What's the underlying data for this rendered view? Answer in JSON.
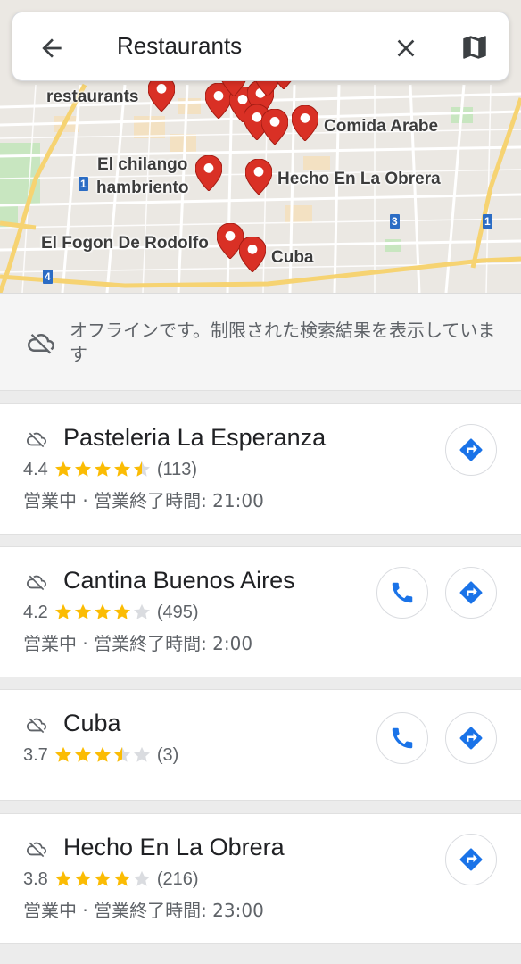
{
  "search": {
    "query": "Restaurants",
    "back_icon": "arrow-back-icon",
    "clear_icon": "close-icon",
    "map_icon": "map-icon"
  },
  "map": {
    "labels": {
      "restaurants": "restaurants",
      "comida_arabe": "Comida Arabe",
      "el_chilango": "El chilango\nhambriento",
      "hecho": "Hecho En La Obrera",
      "fogon": "El Fogon De Rodolfo",
      "cuba": "Cuba"
    },
    "route_badges": {
      "b1": "1",
      "b3": "3",
      "b1b": "1",
      "b4": "4"
    },
    "pin_color": "#d93025"
  },
  "offline_banner": {
    "icon": "cloud-off-icon",
    "message": "オフラインです。制限された検索結果を表示しています"
  },
  "results": [
    {
      "name": "Pasteleria La Esperanza",
      "rating": "4.4",
      "stars": 4.5,
      "reviews": "(113)",
      "hours": "営業中 · 営業終了時間: 21:00",
      "has_call": false
    },
    {
      "name": "Cantina Buenos Aires",
      "rating": "4.2",
      "stars": 4,
      "reviews": "(495)",
      "hours": "営業中 · 営業終了時間: 2:00",
      "has_call": true
    },
    {
      "name": "Cuba",
      "rating": "3.7",
      "stars": 3.5,
      "reviews": "(3)",
      "hours": "",
      "has_call": true
    },
    {
      "name": "Hecho En La Obrera",
      "rating": "3.8",
      "stars": 4,
      "reviews": "(216)",
      "hours": "営業中 · 営業終了時間: 23:00",
      "has_call": false
    }
  ],
  "colors": {
    "star": "#fbbc04",
    "star_empty": "#dadce0",
    "accent": "#1a73e8"
  }
}
